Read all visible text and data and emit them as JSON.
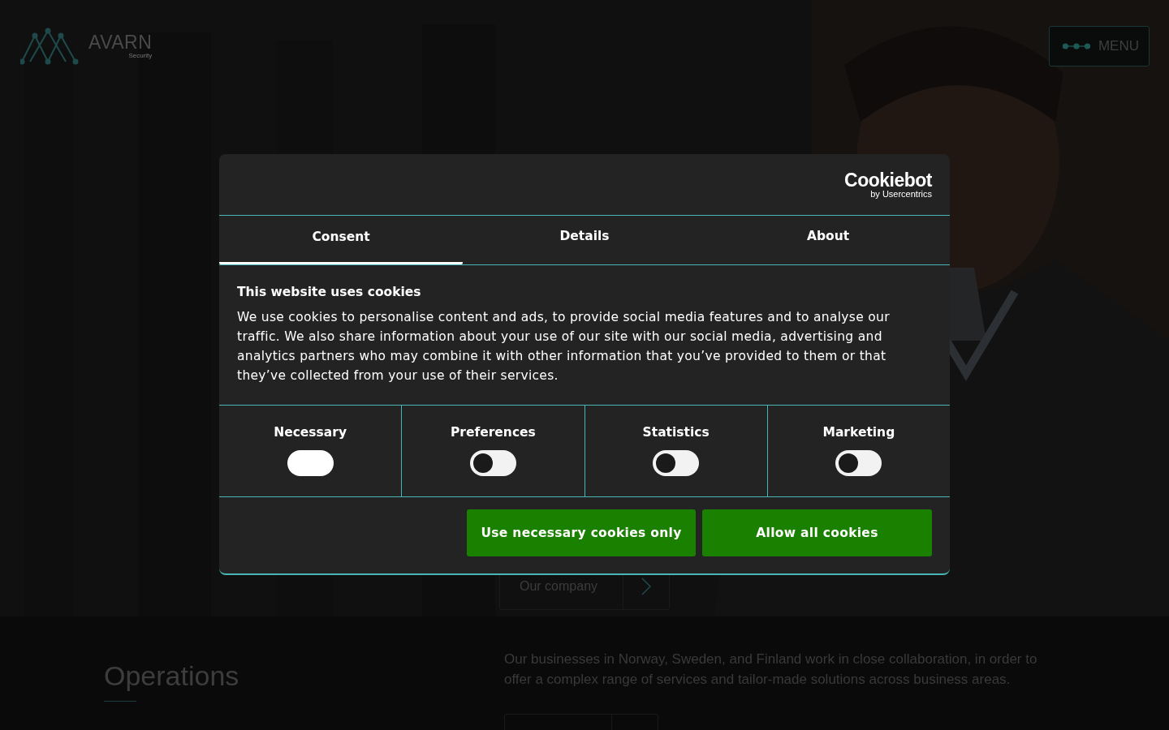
{
  "header": {
    "logo": {
      "name": "AVARN",
      "tagline": "Security"
    },
    "menu_button": {
      "label": "MENU"
    }
  },
  "hero": {
    "button": {
      "label": "Our company"
    }
  },
  "operations": {
    "heading": "Operations",
    "text": "Our businesses in Norway, Sweden, and Finland work in close collaboration, in order to offer a complex range of services and tailor-made solutions across business areas."
  },
  "cookie_dialog": {
    "brand": {
      "name": "Cookiebot",
      "byline": "by Usercentrics"
    },
    "tabs": [
      {
        "label": "Consent",
        "selected": true
      },
      {
        "label": "Details",
        "selected": false
      },
      {
        "label": "About",
        "selected": false
      }
    ],
    "title": "This website uses cookies",
    "body": "We use cookies to personalise content and ads, to provide social media features and to analyse our traffic. We also share information about your use of our site with our social media, advertising and analytics partners who may combine it with other information that you’ve provided to them or that they’ve collected from your use of their services.",
    "categories": [
      {
        "label": "Necessary",
        "checked": true
      },
      {
        "label": "Preferences",
        "checked": false
      },
      {
        "label": "Statistics",
        "checked": false
      },
      {
        "label": "Marketing",
        "checked": false
      }
    ],
    "buttons": [
      "Use necessary cookies only",
      "Allow all cookies"
    ]
  }
}
